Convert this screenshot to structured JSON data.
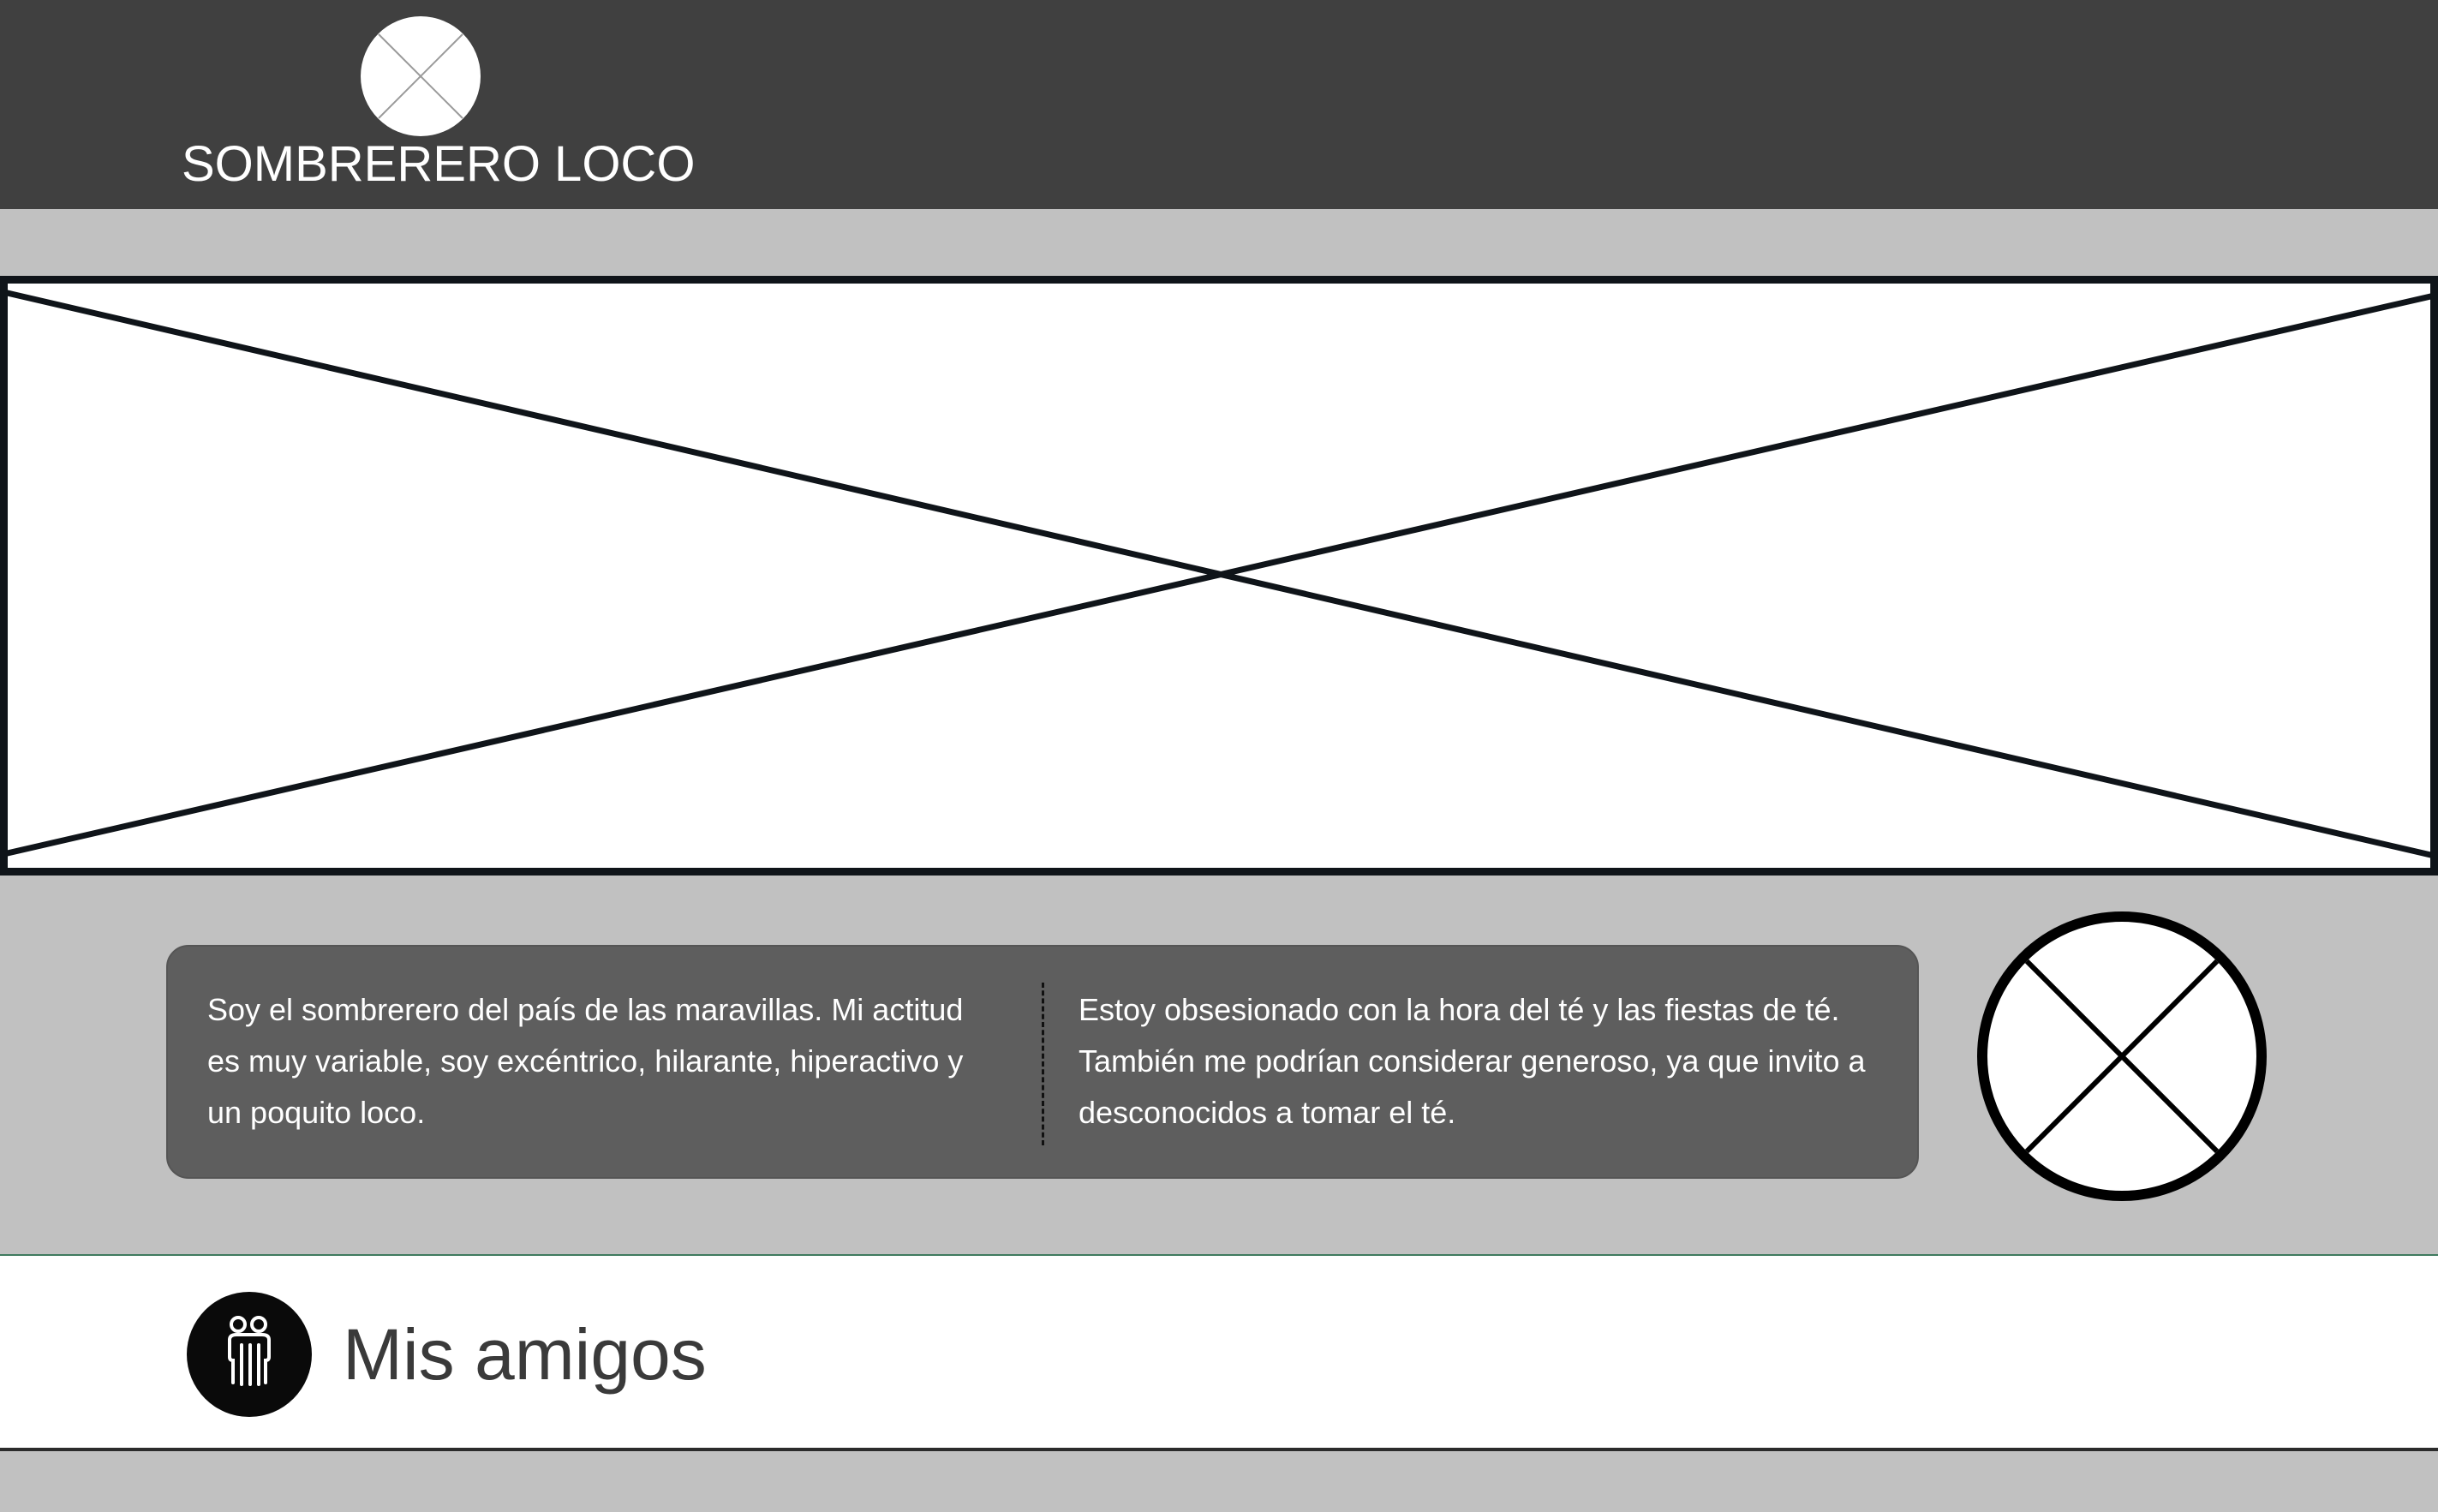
{
  "header": {
    "logo_icon": "image-placeholder-icon",
    "title": "SOMBRERERO LOCO",
    "background": "#404040"
  },
  "hero": {
    "icon": "image-placeholder-icon",
    "background": "#ffffff"
  },
  "about": {
    "left_text": "Soy el sombrerero del país de las maravillas. Mi actitud es muy variable, soy excéntrico, hilarante, hiperactivo y un poquito loco.",
    "right_text": "Estoy obsesionado con la hora del té y las fiestas de té. También me podrían considerar generoso, ya que invito a desconocidos a tomar el té.",
    "card_color": "#5e5e5e"
  },
  "avatar": {
    "icon": "image-placeholder-icon"
  },
  "friends": {
    "icon": "friends-icon",
    "title": "Mis amigos"
  },
  "colors": {
    "page_background": "#c1c1c1",
    "text_on_dark": "#ffffff"
  }
}
